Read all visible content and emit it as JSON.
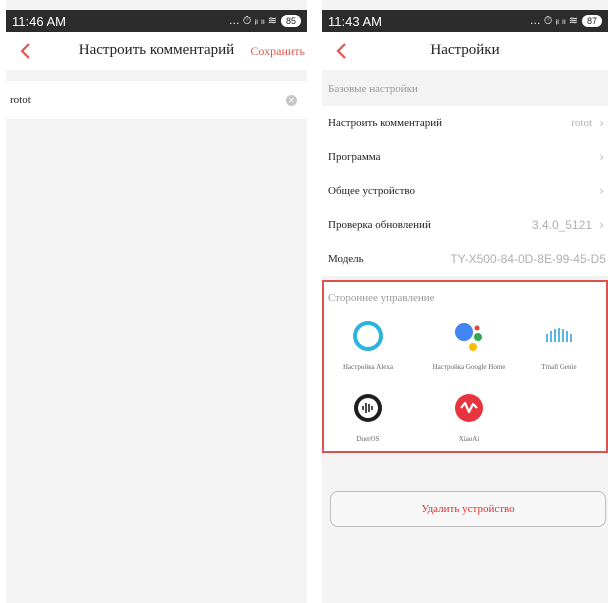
{
  "left": {
    "status": {
      "time": "11:46 AM",
      "icons": "… ⏱ ᵢₗ ₗₗ ≋",
      "battery": "85"
    },
    "nav": {
      "title": "Настроить комментарий",
      "save": "Сохранить"
    },
    "input": {
      "value": "rotot"
    }
  },
  "right": {
    "status": {
      "time": "11:43 AM",
      "icons": "… ⏱ ᵢₗ ₗₗ ≋",
      "battery": "87"
    },
    "nav": {
      "title": "Настройки"
    },
    "basic_header": "Базовые настройки",
    "rows": [
      {
        "label": "Настроить комментарий",
        "value": "rotot"
      },
      {
        "label": "Программа",
        "value": ""
      },
      {
        "label": "Общее устройство",
        "value": ""
      },
      {
        "label": "Проверка обновлений",
        "value": "3.4.0_5121"
      },
      {
        "label": "Модель",
        "value": "TY-X500-84-0D-8E-99-45-D5"
      }
    ],
    "third_party": {
      "header": "Стороннее управление",
      "assistants": [
        {
          "label": "Настройка Alexa",
          "icon": "alexa-icon"
        },
        {
          "label": "Настройка Google Home",
          "icon": "google-assistant-icon"
        },
        {
          "label": "Tmall Genie",
          "icon": "tmall-genie-icon"
        },
        {
          "label": "DuerOS",
          "icon": "dueros-icon"
        },
        {
          "label": "XiaoAi",
          "icon": "xiaoai-icon"
        }
      ]
    },
    "delete_label": "Удалить устройство"
  },
  "colors": {
    "accent": "#e2574c",
    "highlight_border": "#d9534f",
    "status_bar": "#2c2c2c"
  }
}
